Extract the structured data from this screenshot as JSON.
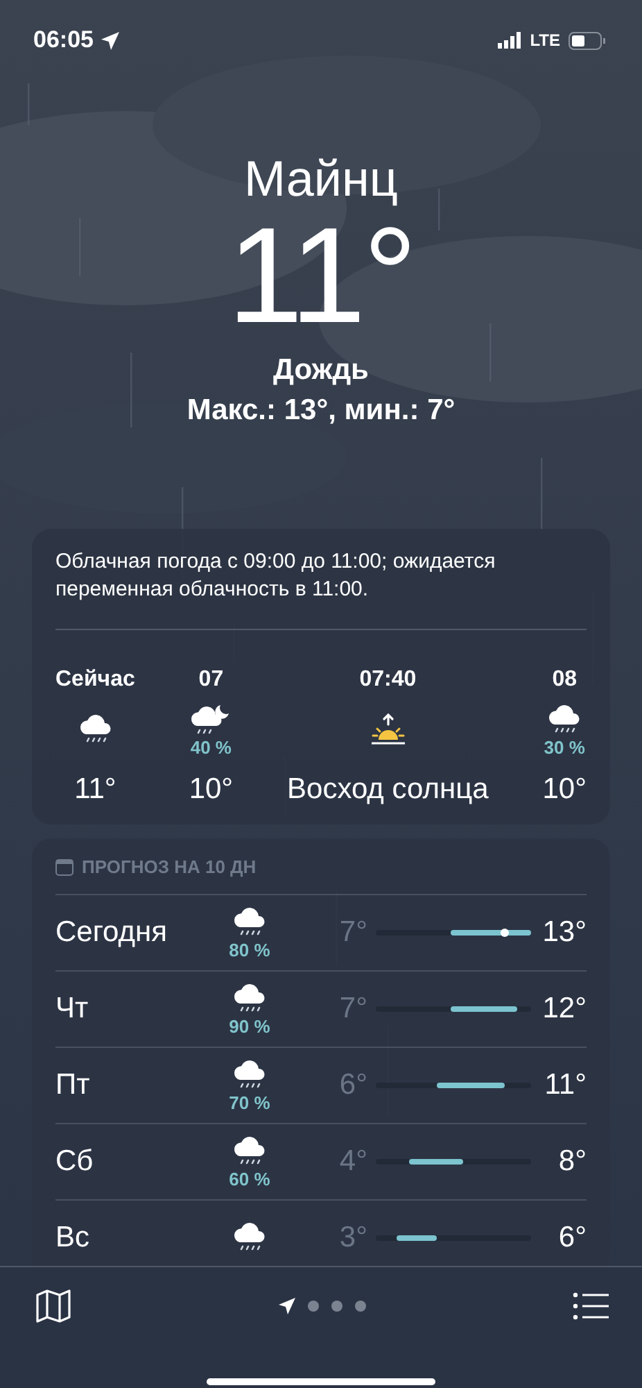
{
  "status_bar": {
    "time": "06:05",
    "network": "LTE"
  },
  "hero": {
    "city": "Майнц",
    "temperature": "11°",
    "condition": "Дождь",
    "high_low": "Макс.: 13°, мин.: 7°"
  },
  "hourly_card": {
    "summary": "Облачная погода с 09:00 до 11:00; ожидается переменная облачность в 11:00.",
    "hours": [
      {
        "kind": "rain",
        "time": "Сейчас",
        "temp": "11°"
      },
      {
        "kind": "moon-rain",
        "time": "07",
        "chance": "40 %",
        "temp": "10°"
      },
      {
        "kind": "sunrise",
        "time": "07:40",
        "temp": "Восход солнца"
      },
      {
        "kind": "rain",
        "time": "08",
        "chance": "30 %",
        "temp": "10°"
      }
    ]
  },
  "forecast_card": {
    "title": "ПРОГНОЗ НА 10 ДН",
    "days": [
      {
        "day": "Сегодня",
        "chance": "80 %",
        "low": "7°",
        "high": "13°",
        "current": true
      },
      {
        "day": "Чт",
        "chance": "90 %",
        "low": "7°",
        "high": "12°",
        "current": false
      },
      {
        "day": "Пт",
        "chance": "70 %",
        "low": "6°",
        "high": "11°",
        "current": false
      },
      {
        "day": "Сб",
        "chance": "60 %",
        "low": "4°",
        "high": "8°",
        "current": false
      },
      {
        "day": "Вс",
        "low": "3°",
        "high": "6°",
        "current": false
      }
    ]
  },
  "pages": [
    {
      "kind": "location",
      "selected": true
    },
    {
      "kind": "dot",
      "selected": false
    },
    {
      "kind": "dot",
      "selected": false
    },
    {
      "kind": "dot",
      "selected": false
    }
  ]
}
